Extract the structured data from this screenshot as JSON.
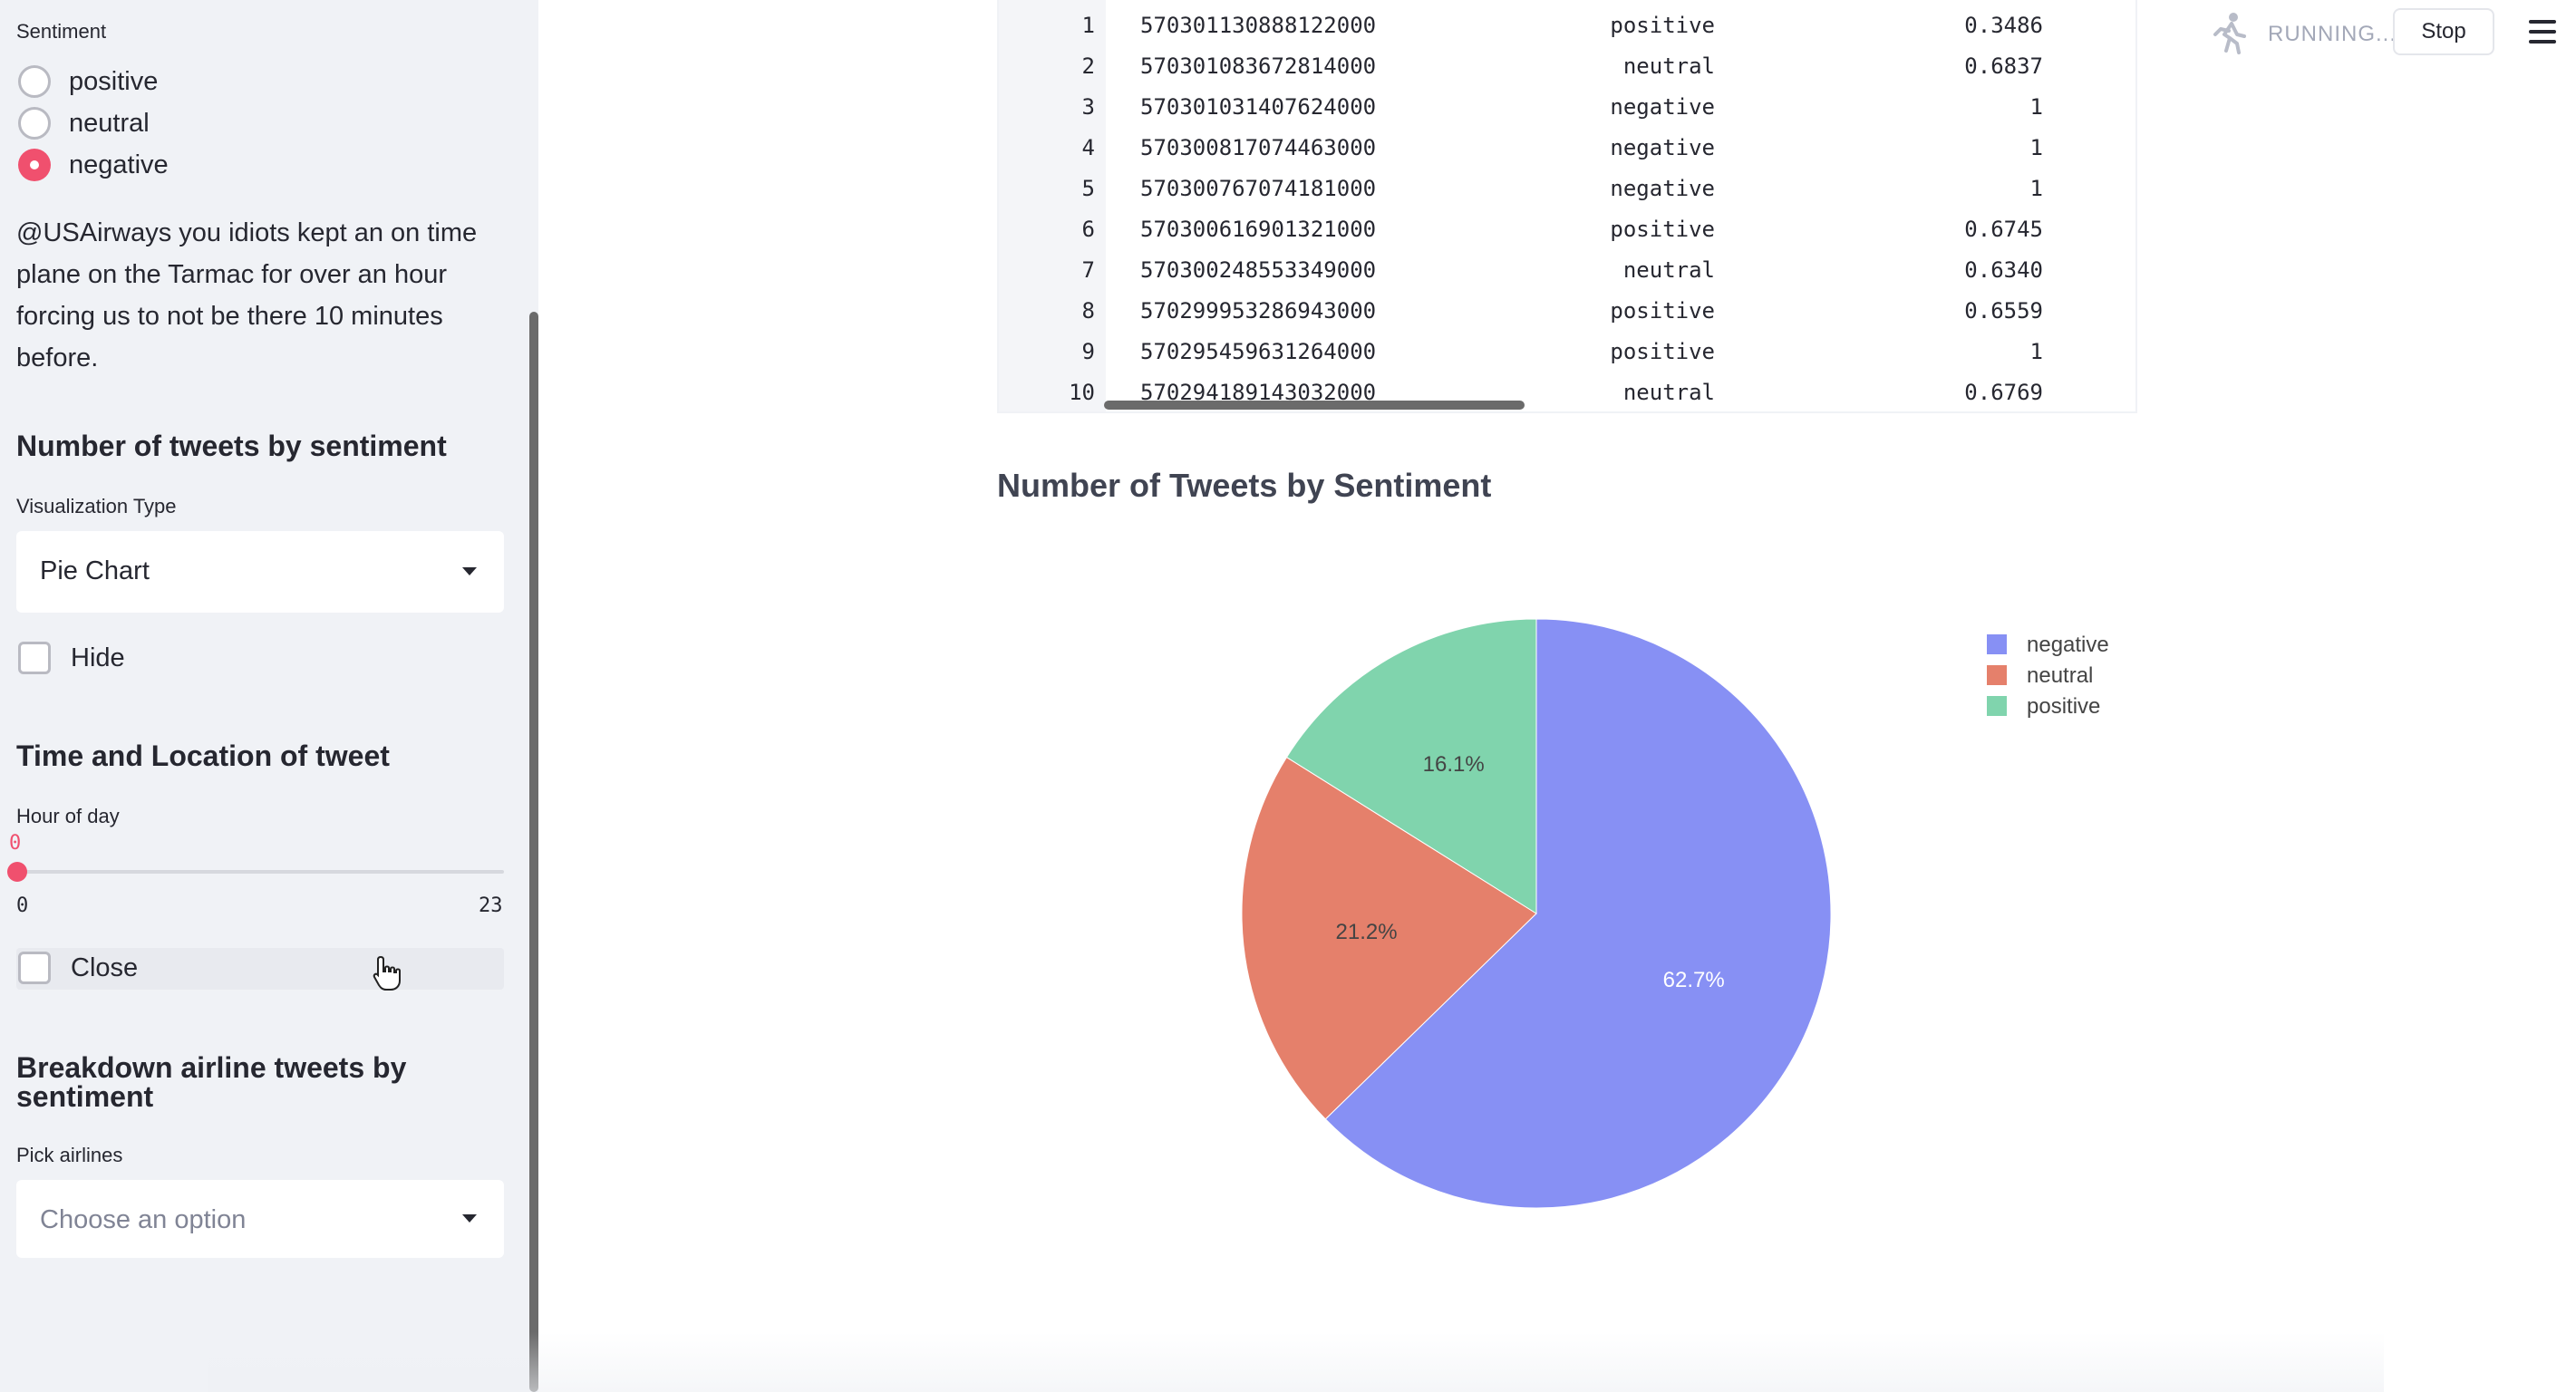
{
  "sidebar": {
    "sentiment_label": "Sentiment",
    "radio_options": [
      {
        "label": "positive",
        "selected": false
      },
      {
        "label": "neutral",
        "selected": false
      },
      {
        "label": "negative",
        "selected": true
      }
    ],
    "tweet_text": "@USAirways you idiots kept an on time plane on the Tarmac for over an hour forcing us to not be there 10 minutes before.",
    "section_number_title": "Number of tweets by sentiment",
    "viz_type_label": "Visualization Type",
    "viz_type_value": "Pie Chart",
    "hide_label": "Hide",
    "section_time_title": "Time and Location of tweet",
    "hour_label": "Hour of day",
    "hour_value": "0",
    "hour_min": "0",
    "hour_max": "23",
    "close_label": "Close",
    "section_breakdown_title": "Breakdown airline tweets by sentiment",
    "pick_airlines_label": "Pick airlines",
    "pick_airlines_placeholder": "Choose an option"
  },
  "header": {
    "status_text": "RUNNING...",
    "stop_label": "Stop"
  },
  "table": {
    "rows": [
      {
        "index": "1",
        "tweet_id": "570301130888122000",
        "sentiment": "positive",
        "confidence": "0.3486"
      },
      {
        "index": "2",
        "tweet_id": "570301083672814000",
        "sentiment": "neutral",
        "confidence": "0.6837"
      },
      {
        "index": "3",
        "tweet_id": "570301031407624000",
        "sentiment": "negative",
        "confidence": "1"
      },
      {
        "index": "4",
        "tweet_id": "570300817074463000",
        "sentiment": "negative",
        "confidence": "1"
      },
      {
        "index": "5",
        "tweet_id": "570300767074181000",
        "sentiment": "negative",
        "confidence": "1"
      },
      {
        "index": "6",
        "tweet_id": "570300616901321000",
        "sentiment": "positive",
        "confidence": "0.6745"
      },
      {
        "index": "7",
        "tweet_id": "570300248553349000",
        "sentiment": "neutral",
        "confidence": "0.6340"
      },
      {
        "index": "8",
        "tweet_id": "570299953286943000",
        "sentiment": "positive",
        "confidence": "0.6559"
      },
      {
        "index": "9",
        "tweet_id": "570295459631264000",
        "sentiment": "positive",
        "confidence": "1"
      },
      {
        "index": "10",
        "tweet_id": "570294189143032000",
        "sentiment": "neutral",
        "confidence": "0.6769"
      }
    ]
  },
  "chart_title": "Number of Tweets by Sentiment",
  "chart_data": {
    "type": "pie",
    "slices": [
      {
        "label": "negative",
        "value": 62.7,
        "text": "62.7%",
        "color": "#8790f4"
      },
      {
        "label": "neutral",
        "value": 21.2,
        "text": "21.2%",
        "color": "#e5806b"
      },
      {
        "label": "positive",
        "value": 16.1,
        "text": "16.1%",
        "color": "#80d4ad"
      }
    ],
    "legend": [
      "negative",
      "neutral",
      "positive"
    ],
    "legend_position": "top-right"
  },
  "colors": {
    "accent": "#f0506e",
    "sidebar_bg": "#f0f2f6"
  }
}
